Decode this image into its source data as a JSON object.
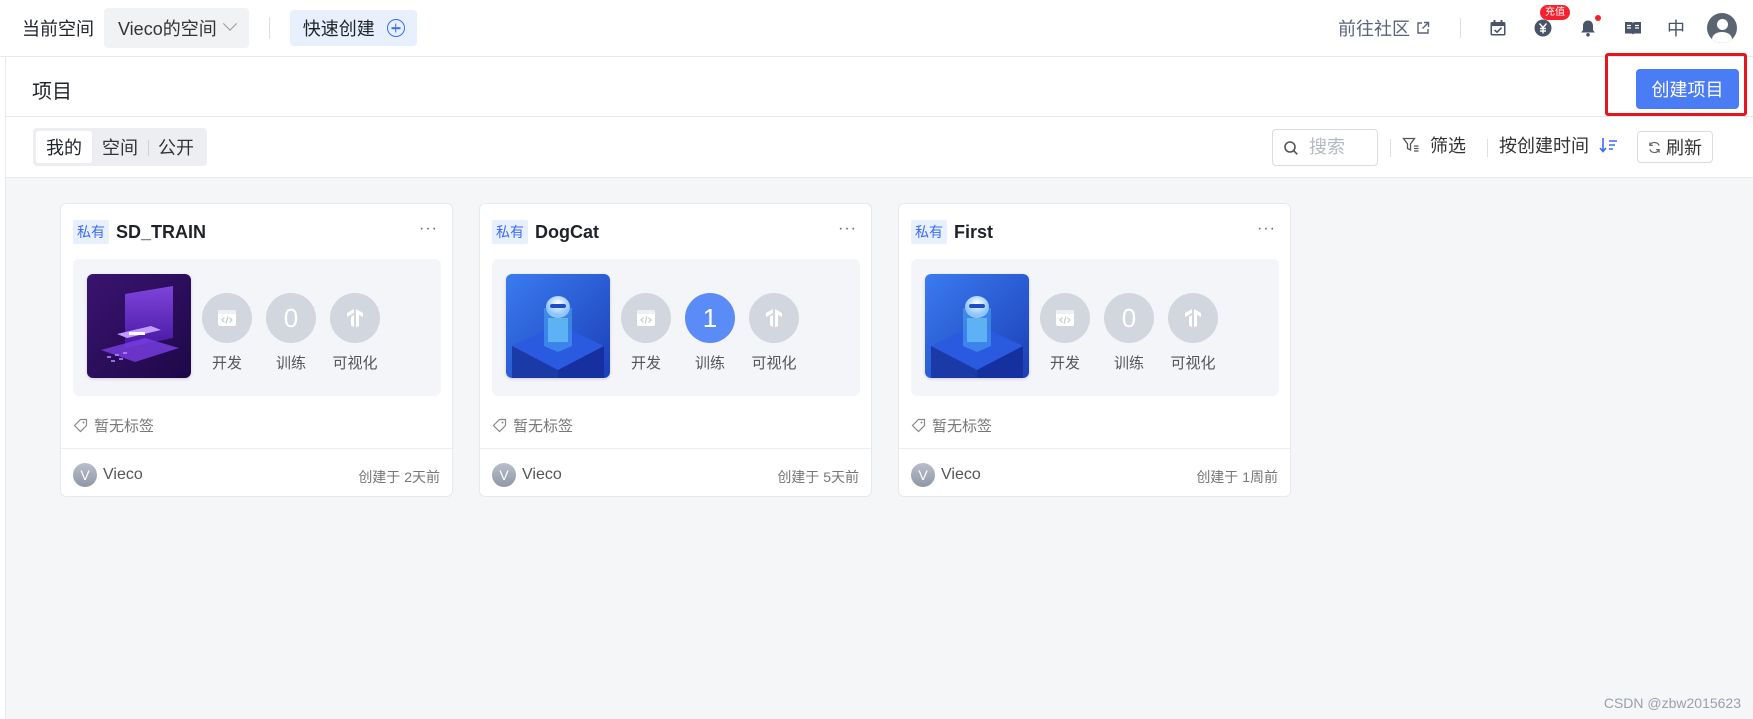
{
  "topbar": {
    "space_label": "当前空间",
    "space_name": "Vieco的空间",
    "quick_create": "快速创建",
    "community": "前往社区",
    "recharge_badge": "充值",
    "lang": "中"
  },
  "page": {
    "title": "项目",
    "create_button": "创建项目"
  },
  "toolbar": {
    "tabs": [
      "我的",
      "空间",
      "公开"
    ],
    "search_placeholder": "搜索",
    "filter": "筛选",
    "sort": "按创建时间",
    "refresh": "刷新"
  },
  "stat_labels": [
    "开发",
    "训练",
    "可视化"
  ],
  "projects": [
    {
      "visibility": "私有",
      "name": "SD_TRAIN",
      "train_count": "0",
      "tags": "暂无标签",
      "owner_initial": "V",
      "owner": "Vieco",
      "created": "创建于 2天前"
    },
    {
      "visibility": "私有",
      "name": "DogCat",
      "train_count": "1",
      "tags": "暂无标签",
      "owner_initial": "V",
      "owner": "Vieco",
      "created": "创建于 5天前"
    },
    {
      "visibility": "私有",
      "name": "First",
      "train_count": "0",
      "tags": "暂无标签",
      "owner_initial": "V",
      "owner": "Vieco",
      "created": "创建于 1周前"
    }
  ],
  "watermark": "CSDN @zbw2015623",
  "colors": {
    "accent": "#4a7cf6",
    "highlight": "#e8141c",
    "badge": "#f5222d"
  }
}
